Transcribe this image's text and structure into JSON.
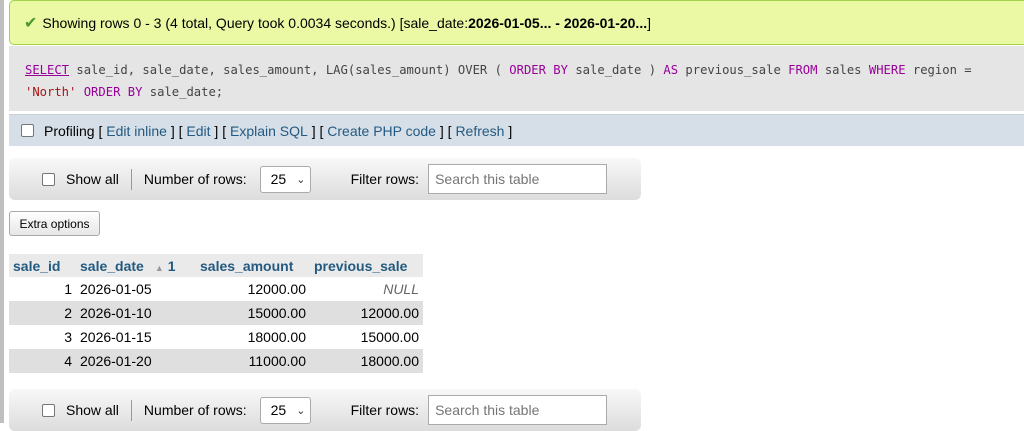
{
  "message": {
    "icon": "check-icon",
    "text_before": "Showing rows 0 - 3 (4 total, Query took 0.0034 seconds.) [sale_date: ",
    "range": "2026-01-05... - 2026-01-20...",
    "text_after": "]"
  },
  "query": {
    "line1": [
      "SELECT",
      " sale_id, sale_date, sales_amount, LAG(sales_amount) OVER ( ",
      "ORDER BY",
      " sale_date ) ",
      "AS",
      " previous_sale ",
      "FROM",
      " sales ",
      "WHERE",
      " region ="
    ],
    "line2": [
      "'North'",
      " ",
      "ORDER BY",
      " sale_date;"
    ]
  },
  "profiling": {
    "label": "Profiling",
    "links": [
      "Edit inline",
      "Edit",
      "Explain SQL",
      "Create PHP code",
      "Refresh"
    ]
  },
  "nav": {
    "show_all": "Show all",
    "rows_label": "Number of rows:",
    "rows_value": "25",
    "filter_label": "Filter rows:",
    "filter_placeholder": "Search this table"
  },
  "extra_options": "Extra options",
  "table": {
    "headers": [
      "sale_id",
      "sale_date",
      "sales_amount",
      "previous_sale"
    ],
    "sort_index": "1",
    "rows": [
      [
        "1",
        "2026-01-05",
        "12000.00",
        "NULL"
      ],
      [
        "2",
        "2026-01-10",
        "15000.00",
        "12000.00"
      ],
      [
        "3",
        "2026-01-15",
        "18000.00",
        "15000.00"
      ],
      [
        "4",
        "2026-01-20",
        "11000.00",
        "18000.00"
      ]
    ]
  },
  "colors": {
    "success_bg": "#ebf8a4",
    "keyword": "#990099",
    "string": "#aa1111",
    "link": "#235a81"
  }
}
